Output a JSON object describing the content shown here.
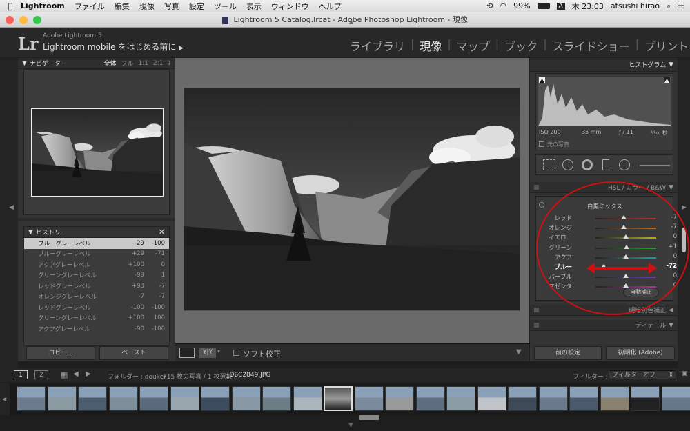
{
  "menubar": {
    "app": "Lightroom",
    "items": [
      "ファイル",
      "編集",
      "現像",
      "写真",
      "設定",
      "ツール",
      "表示",
      "ウィンドウ",
      "ヘルプ"
    ],
    "battery": "99%",
    "input_mode": "A",
    "clock": "木 23:03",
    "user": "atsushi hirao"
  },
  "window": {
    "title": "Lightroom 5 Catalog.lrcat - Adobe Photoshop Lightroom - 現像"
  },
  "header": {
    "logo": "Lr",
    "version": "Adobe Lightroom 5",
    "mobile": "Lightroom mobile をはじめる前に",
    "modules": [
      "ライブラリ",
      "現像",
      "マップ",
      "ブック",
      "スライドショー",
      "プリント"
    ],
    "active_module": "現像"
  },
  "navigator": {
    "title": "ナビゲーター",
    "zoom": [
      "全体",
      "フル",
      "1:1",
      "2:1"
    ]
  },
  "history": {
    "title": "ヒストリー",
    "rows": [
      {
        "name": "ブルーグレーレベル",
        "a": "-29",
        "b": "-100",
        "sel": true
      },
      {
        "name": "ブルーグレーレベル",
        "a": "+29",
        "b": "-71"
      },
      {
        "name": "アクアグレーレベル",
        "a": "+100",
        "b": "0"
      },
      {
        "name": "グリーングレーレベル",
        "a": "-99",
        "b": "1"
      },
      {
        "name": "レッドグレーレベル",
        "a": "+93",
        "b": "-7"
      },
      {
        "name": "オレンジグレーレベル",
        "a": "-7",
        "b": "-7"
      },
      {
        "name": "レッドグレーレベル",
        "a": "-100",
        "b": "-100"
      },
      {
        "name": "グリーングレーレベル",
        "a": "+100",
        "b": "100"
      },
      {
        "name": "アクアグレーレベル",
        "a": "-90",
        "b": "-100"
      }
    ]
  },
  "left_buttons": {
    "copy": "コピー...",
    "paste": "ペースト"
  },
  "toolbar": {
    "softproof": "ソフト校正"
  },
  "histogram": {
    "title": "ヒストグラム",
    "iso": "ISO 200",
    "focal": "35 mm",
    "aperture": "ƒ / 11",
    "shutter": "¹⁄₅₀₀ 秒",
    "original": "元の写真"
  },
  "hsl": {
    "tabs": "HSL  /  カラー  /  B&W",
    "section": "白黒ミックス",
    "auto": "自動補正",
    "sliders": [
      {
        "label": "レッド",
        "value": "-7",
        "pos": 0.47,
        "color": "#c03030"
      },
      {
        "label": "オレンジ",
        "value": "-7",
        "pos": 0.47,
        "color": "#c07020"
      },
      {
        "label": "イエロー",
        "value": "0",
        "pos": 0.5,
        "color": "#c0b020"
      },
      {
        "label": "グリーン",
        "value": "+1",
        "pos": 0.51,
        "color": "#30a030"
      },
      {
        "label": "アクア",
        "value": "0",
        "pos": 0.5,
        "color": "#20a0a0"
      },
      {
        "label": "ブルー",
        "value": "-72",
        "pos": 0.14,
        "color": "#3050c0"
      },
      {
        "label": "パープル",
        "value": "0",
        "pos": 0.5,
        "color": "#7040b0"
      },
      {
        "label": "マゼンタ",
        "value": "0",
        "pos": 0.5,
        "color": "#b030a0"
      }
    ]
  },
  "panels": {
    "split_toning": "明暗別色補正",
    "detail": "ディテール"
  },
  "right_buttons": {
    "previous": "前の設定",
    "reset": "初期化 (Adobe)"
  },
  "filmstrip_bar": {
    "page1": "1",
    "page2": "2",
    "folder": "フォルダー : doukei",
    "count": "715 枚の写真 / 1 枚選択 /",
    "file": "_DSC2849.JPG",
    "filter_label": "フィルター :",
    "filter_value": "フィルターオフ"
  }
}
